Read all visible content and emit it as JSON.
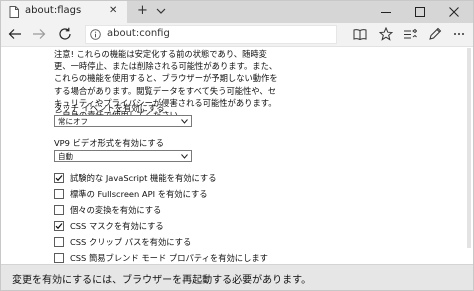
{
  "tab": {
    "title": "about:flags",
    "close_glyph": "✕",
    "new_tab_glyph": "+"
  },
  "address": {
    "url": "about:config"
  },
  "notice": {
    "lines": [
      "注意! これらの機能は安定化する前の状態であり、随時変",
      "更、一時停止、または削除される可能性があります。また、",
      "これらの機能を使用すると、ブラウザーが予期しない動作を",
      "する場合があります。閲覧データをすべて失う可能性や、セ",
      "キュリティやプライバシーが侵害される可能性があります。",
      "ご自身の責任で使用してください。"
    ]
  },
  "settings": [
    {
      "label": "タッチ イベントを有効にする",
      "value": "常にオフ"
    },
    {
      "label": "VP9 ビデオ形式を有効にする",
      "value": "自動"
    }
  ],
  "checkboxes": [
    {
      "label": "試験的な JavaScript 機能を有効にする",
      "checked": true
    },
    {
      "label": "標準の Fullscreen API を有効にする",
      "checked": false
    },
    {
      "label": "個々の変換を有効にする",
      "checked": false
    },
    {
      "label": "CSS マスクを有効にする",
      "checked": true
    },
    {
      "label": "CSS クリップ パスを有効にする",
      "checked": false
    },
    {
      "label": "CSS 簡易ブレンド モード プロパティを有効にします",
      "checked": false
    }
  ],
  "banner": {
    "text": "変更を有効にするには、ブラウザーを再起動する必要があります。"
  },
  "icons": {
    "page": "page-icon",
    "tab_dropdown": "chevron-down-icon",
    "back": "arrow-left-icon",
    "forward": "arrow-right-icon",
    "refresh": "refresh-icon",
    "info": "info-icon",
    "reading_view": "book-icon",
    "favorites": "star-icon",
    "hub": "hub-icon",
    "web_note": "pen-icon",
    "more": "more-icon"
  },
  "colors": {
    "tab_bar": "#d6d6d6",
    "active_tab": "#f2f2f2",
    "banner": "#e6e6e6"
  }
}
